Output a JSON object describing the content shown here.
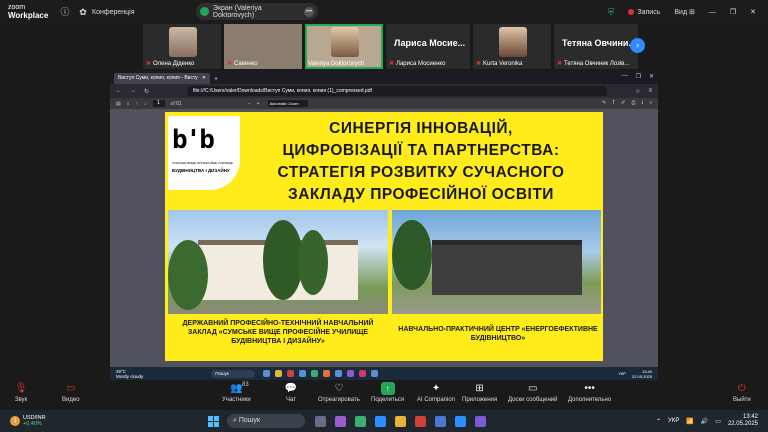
{
  "topbar": {
    "brand_line1": "zoom",
    "brand_line2": "Workplace",
    "conference_label": "Конференція",
    "share_label": "Экран (Valeriya Doktorovych)",
    "record_label": "Запись",
    "view_label": "Вид"
  },
  "participants": [
    {
      "name": "Олена Діденко",
      "muted": true
    },
    {
      "name": "Савенко",
      "muted": true
    },
    {
      "name": "Valeriya Doktorovych",
      "muted": false,
      "active": true
    },
    {
      "name": "Лариса Мосиенко",
      "big_name": "Лариса Мосие...",
      "muted": true
    },
    {
      "name": "Kurta Veronika",
      "muted": true
    },
    {
      "name": "Тетяна Овчиник Лозів...",
      "big_name": "Тетяна Овчини...",
      "muted": true
    }
  ],
  "browser": {
    "tab_title": "Виступ Суми, копия, копия - Висту",
    "url": "file:///C:/Users/valer/Downloads/Виступ Суми, копия, копия (1)_compressed.pdf",
    "page_number": "1",
    "page_total": "of 61",
    "zoom": "Automatic Zoom"
  },
  "slide": {
    "logo_mark": "b'b",
    "logo_sub1": "СУМСЬКЕ ВИЩЕ ПРОФЕСІЙНЕ УЧИЛИЩЕ",
    "logo_sub2": "БУДІВНИЦТВА І ДИЗАЙНУ",
    "title_lines": [
      "СИНЕРГІЯ ІННОВАЦІЙ,",
      "ЦИФРОВІЗАЦІЇ ТА ПАРТНЕРСТВА:",
      "СТРАТЕГІЯ РОЗВИТКУ СУЧАСНОГО",
      "ЗАКЛАДУ ПРОФЕСІЙНОЇ ОСВІТИ"
    ],
    "caption_left": "ДЕРЖАВНИЙ ПРОФЕСІЙНО-ТЕХНІЧНИЙ НАВЧАЛЬНИЙ ЗАКЛАД «СУМСЬКЕ ВИЩЕ ПРОФЕСІЙНЕ УЧИЛИЩЕ БУДІВНИЦТВА І ДИЗАЙНУ»",
    "caption_right": "НАВЧАЛЬНО-ПРАКТИЧНИЙ ЦЕНТР «ЕНЕРГОЕФЕКТИВНЕ БУДІВНИЦТВО»"
  },
  "vm_taskbar": {
    "weather": "29°C",
    "weather_desc": "Mostly cloudy",
    "search": "Пошук",
    "lang": "УКР",
    "time": "13:40",
    "date": "22.05.2025"
  },
  "controls": {
    "sound": "Звук",
    "video": "Видео",
    "participants": "Участники",
    "participants_count": "83",
    "chat": "Чат",
    "react": "Отреагировать",
    "share": "Поделиться",
    "ai": "AI Companion",
    "apps": "Приложения",
    "boards": "Доски сообщений",
    "more": "Дополнительно",
    "leave": "Выйти"
  },
  "taskbar": {
    "ticker": "USD/INR",
    "change": "+0.40%",
    "badge": "1",
    "search": "Пошук",
    "lang": "УКР",
    "time": "13:42",
    "date": "22.05.2025"
  }
}
